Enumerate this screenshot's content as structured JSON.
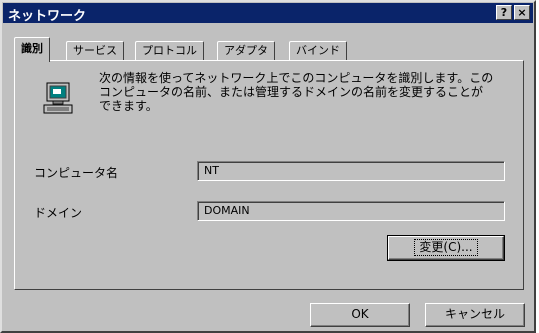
{
  "window": {
    "title": "ネットワーク",
    "help_label": "?",
    "close_label": "×"
  },
  "tabs": [
    {
      "label": "識別",
      "active": true
    },
    {
      "label": "サービス",
      "active": false
    },
    {
      "label": "プロトコル",
      "active": false
    },
    {
      "label": "アダプタ",
      "active": false
    },
    {
      "label": "バインド",
      "active": false
    }
  ],
  "identification": {
    "description_lines": [
      "次の情報を使ってネットワーク上でこのコンピュータを識別します。この",
      "コンピュータの名前、または管理するドメインの名前を変更することが",
      "できます。"
    ],
    "computer_name_label": "コンピュータ名",
    "computer_name_value": "NT",
    "domain_label": "ドメイン",
    "domain_value": "DOMAIN",
    "change_button": "変更(C)..."
  },
  "footer": {
    "ok_label": "OK",
    "cancel_label": "キャンセル"
  },
  "colors": {
    "titlebar": "#0a246a",
    "face": "#c0c0c0"
  }
}
